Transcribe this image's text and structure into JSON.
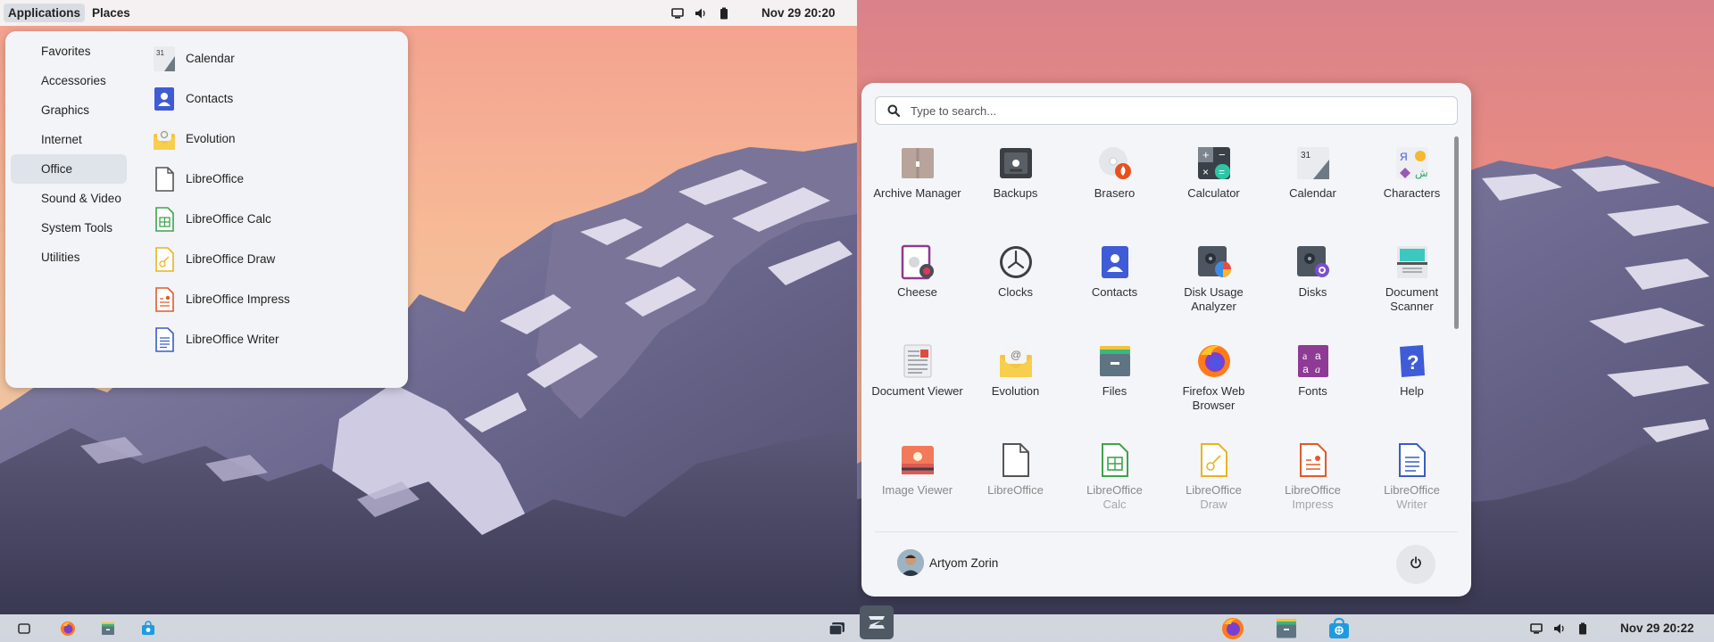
{
  "left_screen": {
    "topbar": {
      "applications_label": "Applications",
      "places_label": "Places",
      "clock": "Nov 29  20:20",
      "tray_icons": [
        "display-icon",
        "volume-icon",
        "battery-icon"
      ]
    },
    "menu": {
      "categories": [
        "Favorites",
        "Accessories",
        "Graphics",
        "Internet",
        "Office",
        "Sound & Video",
        "System Tools",
        "Utilities"
      ],
      "selected_category": "Office",
      "apps": [
        {
          "label": "Calendar",
          "icon": "calendar-icon"
        },
        {
          "label": "Contacts",
          "icon": "contacts-icon"
        },
        {
          "label": "Evolution",
          "icon": "evolution-icon"
        },
        {
          "label": "LibreOffice",
          "icon": "libreoffice-icon"
        },
        {
          "label": "LibreOffice Calc",
          "icon": "libreoffice-calc-icon"
        },
        {
          "label": "LibreOffice Draw",
          "icon": "libreoffice-draw-icon"
        },
        {
          "label": "LibreOffice Impress",
          "icon": "libreoffice-impress-icon"
        },
        {
          "label": "LibreOffice Writer",
          "icon": "libreoffice-writer-icon"
        }
      ]
    },
    "taskbar_icons": [
      "show-desktop-icon",
      "firefox-icon",
      "files-icon",
      "software-store-icon",
      "workspace-switcher-icon"
    ]
  },
  "right_screen": {
    "search": {
      "placeholder": "Type to search..."
    },
    "apps": [
      {
        "label": "Archive Manager",
        "icon": "archive-manager-icon"
      },
      {
        "label": "Backups",
        "icon": "backups-icon"
      },
      {
        "label": "Brasero",
        "icon": "brasero-icon"
      },
      {
        "label": "Calculator",
        "icon": "calculator-icon"
      },
      {
        "label": "Calendar",
        "icon": "calendar-icon"
      },
      {
        "label": "Characters",
        "icon": "characters-icon"
      },
      {
        "label": "Cheese",
        "icon": "cheese-icon"
      },
      {
        "label": "Clocks",
        "icon": "clocks-icon"
      },
      {
        "label": "Contacts",
        "icon": "contacts-icon"
      },
      {
        "label": "Disk Usage Analyzer",
        "icon": "disk-usage-analyzer-icon"
      },
      {
        "label": "Disks",
        "icon": "disks-icon"
      },
      {
        "label": "Document Scanner",
        "icon": "document-scanner-icon"
      },
      {
        "label": "Document Viewer",
        "icon": "document-viewer-icon"
      },
      {
        "label": "Evolution",
        "icon": "evolution-icon"
      },
      {
        "label": "Files",
        "icon": "files-icon"
      },
      {
        "label": "Firefox Web Browser",
        "icon": "firefox-icon"
      },
      {
        "label": "Fonts",
        "icon": "fonts-icon"
      },
      {
        "label": "Help",
        "icon": "help-icon"
      },
      {
        "label": "Image Viewer",
        "icon": "image-viewer-icon"
      },
      {
        "label": "LibreOffice",
        "icon": "libreoffice-icon"
      },
      {
        "label": "LibreOffice",
        "sub": "Calc",
        "icon": "libreoffice-calc-icon"
      },
      {
        "label": "LibreOffice",
        "sub": "Draw",
        "icon": "libreoffice-draw-icon"
      },
      {
        "label": "LibreOffice",
        "sub": "Impress",
        "icon": "libreoffice-impress-icon"
      },
      {
        "label": "LibreOffice",
        "sub": "Writer",
        "icon": "libreoffice-writer-icon"
      }
    ],
    "user": {
      "name": "Artyom Zorin"
    },
    "power_icon": "power-icon",
    "taskbar": {
      "icons": [
        "zorin-menu-icon",
        "firefox-icon",
        "files-icon",
        "software-store-icon"
      ],
      "tray_icons": [
        "display-icon",
        "volume-icon",
        "battery-icon"
      ],
      "clock": "Nov 29  20:22"
    }
  },
  "colors": {
    "panel_bg": "#f3f4f7",
    "selected_bg": "#dfe3ea",
    "text": "#222222",
    "faded_text": "#888888",
    "accent_blue": "#3f5bd6"
  }
}
